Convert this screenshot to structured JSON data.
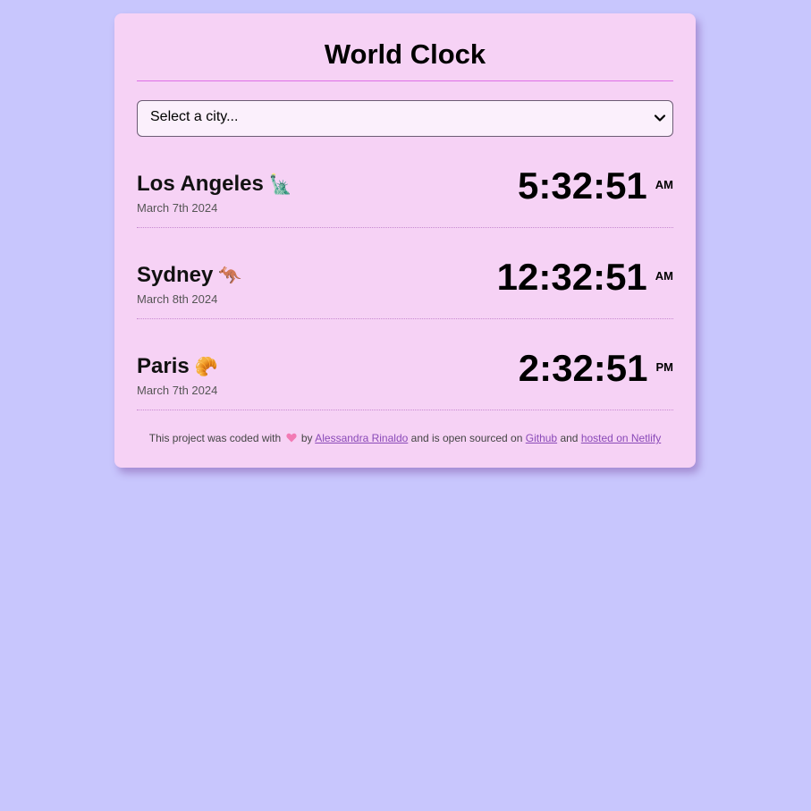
{
  "app": {
    "title": "World Clock"
  },
  "select": {
    "placeholder": "Select a city..."
  },
  "cities": [
    {
      "name": "Los Angeles",
      "emoji": "🗽",
      "date": "March 7th 2024",
      "time": "5:32:51",
      "ampm": "AM"
    },
    {
      "name": "Sydney",
      "emoji": "🦘",
      "date": "March 8th 2024",
      "time": "12:32:51",
      "ampm": "AM"
    },
    {
      "name": "Paris",
      "emoji": "🥐",
      "date": "March 7th 2024",
      "time": "2:32:51",
      "ampm": "PM"
    }
  ],
  "footer": {
    "text1": "This project was coded with",
    "heart_icon": "heart-icon",
    "text2": "by",
    "author_link": "Alessandra Rinaldo",
    "text3": "and is open sourced on",
    "github_link": "Github",
    "text4": "and",
    "netlify_link": "hosted on Netlify"
  },
  "colors": {
    "background": "#c8c6fd",
    "card": "#f6d2f5",
    "accent_rule": "#dd6fe6",
    "link": "#8a4ab8",
    "heart": "#f27ab4"
  }
}
